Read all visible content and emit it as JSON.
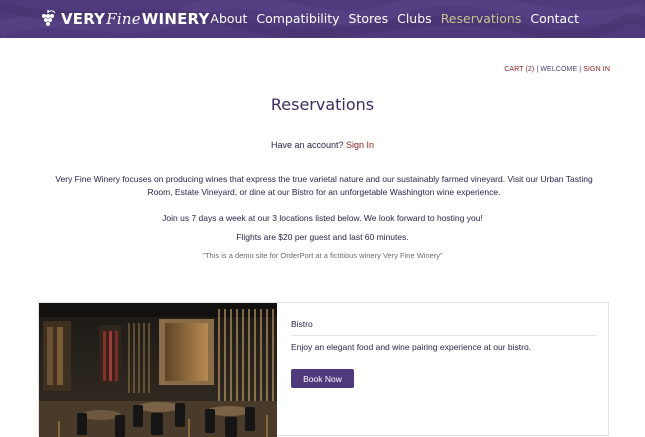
{
  "header": {
    "logo": {
      "very": "VERY",
      "fine": "Fine",
      "winery": "WINERY",
      "icon": "grape-icon"
    },
    "nav": [
      {
        "label": "About"
      },
      {
        "label": "Compatibility"
      },
      {
        "label": "Stores"
      },
      {
        "label": "Clubs"
      },
      {
        "label": "Reservations",
        "active": true
      },
      {
        "label": "Contact"
      }
    ]
  },
  "account": {
    "cart": "CART (2)",
    "sep1": " | ",
    "welcome": "WELCOME",
    "sep2": " | ",
    "signin": "SIGN IN"
  },
  "page": {
    "title": "Reservations",
    "have_account_text": "Have an account? ",
    "sign_in_link": "Sign In",
    "intro": "Very Fine Winery focuses on producing wines that express the true varietal nature and our sustainably farmed vineyard. Visit our Urban Tasting Room, Estate Vineyard, or dine at our Bistro for an unforgetable Washington wine experience.",
    "line1": "Join us 7 days a week at our 3 locations listed below. We look forward to hosting you!",
    "line2": "Flights are $20 per guest and last 60 minutes.",
    "line3": "\"This is a demo site for OrderPort at a fictitious winery Very Fine Winery\""
  },
  "locations": [
    {
      "name": "Bistro",
      "description": "Enjoy an elegant food and wine pairing experience at our bistro.",
      "button": "Book Now"
    }
  ],
  "colors": {
    "brand": "#4f3a7e",
    "accent_link": "#8a1b1b",
    "active_nav": "#c9c48e"
  }
}
